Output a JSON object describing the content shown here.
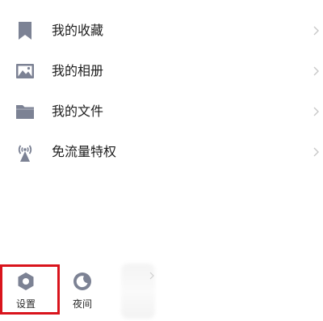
{
  "menu": {
    "items": [
      {
        "label": "我的收藏",
        "icon": "bookmark-icon"
      },
      {
        "label": "我的相册",
        "icon": "image-icon"
      },
      {
        "label": "我的文件",
        "icon": "folder-icon"
      },
      {
        "label": "免流量特权",
        "icon": "signal-tower-icon"
      }
    ]
  },
  "bottom_bar": {
    "settings_label": "设置",
    "night_label": "夜间"
  },
  "colors": {
    "icon": "#7c8294",
    "highlight": "#d9141c",
    "chevron": "#c8c8c8"
  }
}
